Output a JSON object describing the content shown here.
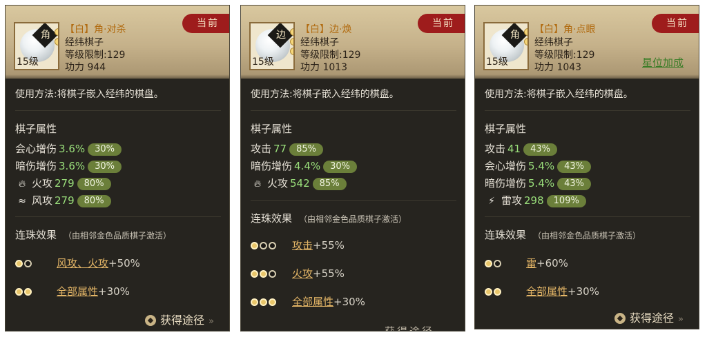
{
  "cards": [
    {
      "level": "15级",
      "badge": "角",
      "title": "【白】角·对杀",
      "subtitle": "经纬棋子",
      "requirement": "等级限制:129",
      "power": "功力 944",
      "current_tag": "当前",
      "usage": "使用方法:将棋子嵌入经纬的棋盘。",
      "attr_title": "棋子属性",
      "attributes": [
        {
          "name": "会心增伤",
          "value": "3.6%",
          "percent": "30%",
          "icon": ""
        },
        {
          "name": "暗伤增伤",
          "value": "3.6%",
          "percent": "30%",
          "icon": ""
        },
        {
          "name": "火攻",
          "value": "279",
          "percent": "80%",
          "icon": "fire-icon"
        },
        {
          "name": "风攻",
          "value": "279",
          "percent": "80%",
          "icon": "wind-icon"
        }
      ],
      "chain_title": "连珠效果",
      "chain_sub": "（由相邻金色品质棋子激活）",
      "chains": [
        {
          "beads": [
            1,
            0
          ],
          "label": "风攻、火攻",
          "bonus": "+50%"
        },
        {
          "beads": [
            1,
            1
          ],
          "label": "全部属性",
          "bonus": "+30%"
        }
      ],
      "obtain": "获得途径"
    },
    {
      "level": "15级",
      "badge": "边",
      "title": "【白】边·焕",
      "subtitle": "经纬棋子",
      "requirement": "等级限制:129",
      "power": "功力 1013",
      "current_tag": "当前",
      "usage": "使用方法:将棋子嵌入经纬的棋盘。",
      "attr_title": "棋子属性",
      "attributes": [
        {
          "name": "攻击",
          "value": "77",
          "percent": "85%",
          "icon": ""
        },
        {
          "name": "暗伤增伤",
          "value": "4.4%",
          "percent": "30%",
          "icon": ""
        },
        {
          "name": "火攻",
          "value": "542",
          "percent": "85%",
          "icon": "fire-icon"
        }
      ],
      "chain_title": "连珠效果",
      "chain_sub": "（由相邻金色品质棋子激活）",
      "chains": [
        {
          "beads": [
            1,
            0,
            0
          ],
          "label": "攻击",
          "bonus": "+55%"
        },
        {
          "beads": [
            1,
            1,
            0
          ],
          "label": "火攻",
          "bonus": "+55%"
        },
        {
          "beads": [
            1,
            1,
            1
          ],
          "label": "全部属性",
          "bonus": "+30%"
        }
      ],
      "obtain_cut": "获得途径"
    },
    {
      "level": "15级",
      "badge": "角",
      "title": "【白】角·点眼",
      "subtitle": "经纬棋子",
      "requirement": "等级限制:129",
      "power": "功力 1043",
      "current_tag": "当前",
      "bonus_link": "星位加成",
      "usage": "使用方法:将棋子嵌入经纬的棋盘。",
      "attr_title": "棋子属性",
      "attributes": [
        {
          "name": "攻击",
          "value": "41",
          "percent": "43%",
          "icon": ""
        },
        {
          "name": "会心增伤",
          "value": "5.4%",
          "percent": "43%",
          "icon": ""
        },
        {
          "name": "暗伤增伤",
          "value": "5.4%",
          "percent": "43%",
          "icon": ""
        },
        {
          "name": "雷攻",
          "value": "298",
          "percent": "109%",
          "icon": "lightning-icon"
        }
      ],
      "chain_title": "连珠效果",
      "chain_sub": "（由相邻金色品质棋子激活）",
      "chains": [
        {
          "beads": [
            1,
            0
          ],
          "label": "雷",
          "bonus": "+60%"
        },
        {
          "beads": [
            1,
            1
          ],
          "label": "全部属性",
          "bonus": "+30%"
        }
      ],
      "obtain": "获得途径"
    }
  ]
}
